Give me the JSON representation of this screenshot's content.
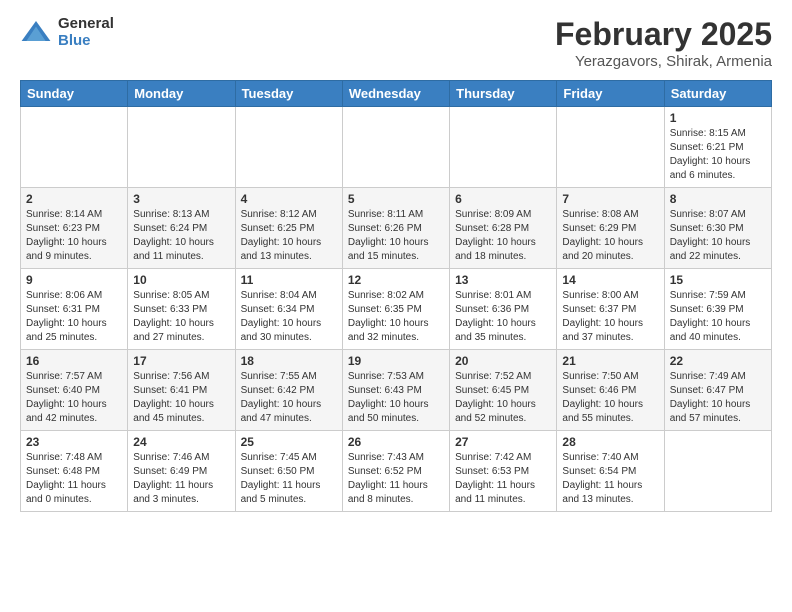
{
  "header": {
    "logo_general": "General",
    "logo_blue": "Blue",
    "title": "February 2025",
    "subtitle": "Yerazgavors, Shirak, Armenia"
  },
  "calendar": {
    "days_of_week": [
      "Sunday",
      "Monday",
      "Tuesday",
      "Wednesday",
      "Thursday",
      "Friday",
      "Saturday"
    ],
    "weeks": [
      [
        {
          "day": "",
          "info": ""
        },
        {
          "day": "",
          "info": ""
        },
        {
          "day": "",
          "info": ""
        },
        {
          "day": "",
          "info": ""
        },
        {
          "day": "",
          "info": ""
        },
        {
          "day": "",
          "info": ""
        },
        {
          "day": "1",
          "info": "Sunrise: 8:15 AM\nSunset: 6:21 PM\nDaylight: 10 hours\nand 6 minutes."
        }
      ],
      [
        {
          "day": "2",
          "info": "Sunrise: 8:14 AM\nSunset: 6:23 PM\nDaylight: 10 hours\nand 9 minutes."
        },
        {
          "day": "3",
          "info": "Sunrise: 8:13 AM\nSunset: 6:24 PM\nDaylight: 10 hours\nand 11 minutes."
        },
        {
          "day": "4",
          "info": "Sunrise: 8:12 AM\nSunset: 6:25 PM\nDaylight: 10 hours\nand 13 minutes."
        },
        {
          "day": "5",
          "info": "Sunrise: 8:11 AM\nSunset: 6:26 PM\nDaylight: 10 hours\nand 15 minutes."
        },
        {
          "day": "6",
          "info": "Sunrise: 8:09 AM\nSunset: 6:28 PM\nDaylight: 10 hours\nand 18 minutes."
        },
        {
          "day": "7",
          "info": "Sunrise: 8:08 AM\nSunset: 6:29 PM\nDaylight: 10 hours\nand 20 minutes."
        },
        {
          "day": "8",
          "info": "Sunrise: 8:07 AM\nSunset: 6:30 PM\nDaylight: 10 hours\nand 22 minutes."
        }
      ],
      [
        {
          "day": "9",
          "info": "Sunrise: 8:06 AM\nSunset: 6:31 PM\nDaylight: 10 hours\nand 25 minutes."
        },
        {
          "day": "10",
          "info": "Sunrise: 8:05 AM\nSunset: 6:33 PM\nDaylight: 10 hours\nand 27 minutes."
        },
        {
          "day": "11",
          "info": "Sunrise: 8:04 AM\nSunset: 6:34 PM\nDaylight: 10 hours\nand 30 minutes."
        },
        {
          "day": "12",
          "info": "Sunrise: 8:02 AM\nSunset: 6:35 PM\nDaylight: 10 hours\nand 32 minutes."
        },
        {
          "day": "13",
          "info": "Sunrise: 8:01 AM\nSunset: 6:36 PM\nDaylight: 10 hours\nand 35 minutes."
        },
        {
          "day": "14",
          "info": "Sunrise: 8:00 AM\nSunset: 6:37 PM\nDaylight: 10 hours\nand 37 minutes."
        },
        {
          "day": "15",
          "info": "Sunrise: 7:59 AM\nSunset: 6:39 PM\nDaylight: 10 hours\nand 40 minutes."
        }
      ],
      [
        {
          "day": "16",
          "info": "Sunrise: 7:57 AM\nSunset: 6:40 PM\nDaylight: 10 hours\nand 42 minutes."
        },
        {
          "day": "17",
          "info": "Sunrise: 7:56 AM\nSunset: 6:41 PM\nDaylight: 10 hours\nand 45 minutes."
        },
        {
          "day": "18",
          "info": "Sunrise: 7:55 AM\nSunset: 6:42 PM\nDaylight: 10 hours\nand 47 minutes."
        },
        {
          "day": "19",
          "info": "Sunrise: 7:53 AM\nSunset: 6:43 PM\nDaylight: 10 hours\nand 50 minutes."
        },
        {
          "day": "20",
          "info": "Sunrise: 7:52 AM\nSunset: 6:45 PM\nDaylight: 10 hours\nand 52 minutes."
        },
        {
          "day": "21",
          "info": "Sunrise: 7:50 AM\nSunset: 6:46 PM\nDaylight: 10 hours\nand 55 minutes."
        },
        {
          "day": "22",
          "info": "Sunrise: 7:49 AM\nSunset: 6:47 PM\nDaylight: 10 hours\nand 57 minutes."
        }
      ],
      [
        {
          "day": "23",
          "info": "Sunrise: 7:48 AM\nSunset: 6:48 PM\nDaylight: 11 hours\nand 0 minutes."
        },
        {
          "day": "24",
          "info": "Sunrise: 7:46 AM\nSunset: 6:49 PM\nDaylight: 11 hours\nand 3 minutes."
        },
        {
          "day": "25",
          "info": "Sunrise: 7:45 AM\nSunset: 6:50 PM\nDaylight: 11 hours\nand 5 minutes."
        },
        {
          "day": "26",
          "info": "Sunrise: 7:43 AM\nSunset: 6:52 PM\nDaylight: 11 hours\nand 8 minutes."
        },
        {
          "day": "27",
          "info": "Sunrise: 7:42 AM\nSunset: 6:53 PM\nDaylight: 11 hours\nand 11 minutes."
        },
        {
          "day": "28",
          "info": "Sunrise: 7:40 AM\nSunset: 6:54 PM\nDaylight: 11 hours\nand 13 minutes."
        },
        {
          "day": "",
          "info": ""
        }
      ]
    ]
  }
}
